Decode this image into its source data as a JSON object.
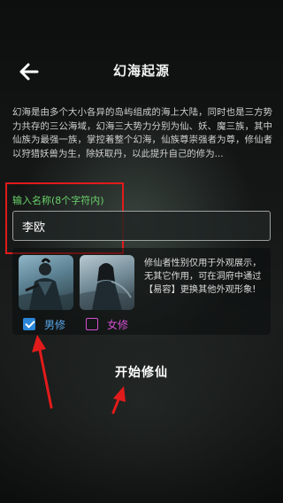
{
  "header": {
    "title": "幻海起源",
    "back_icon": "arrow-left-icon"
  },
  "description": "幻海是由多个大小各异的岛屿组成的海上大陆，同时也是三方势力共存的三公海域，幻海三大势力分别为仙、妖、魔三族，其中仙族为最强一族，掌控着整个幻海，仙族尊崇强者为尊，修仙者以狩猎妖兽为生，除妖取丹，以此提升自己的修为...",
  "name_section": {
    "label": "输入名称(8个字符内)",
    "value": "李欧",
    "highlight_color": "#e11b1b"
  },
  "character": {
    "note": "修仙者性别仅用于外观展示，无其它作用，可在洞府中通过【易容】更换其他外观形象!",
    "options": [
      {
        "label": "男修",
        "checked": true,
        "color": "#2a86d9"
      },
      {
        "label": "女修",
        "checked": false,
        "color": "#d24fd0"
      }
    ]
  },
  "start_button": {
    "label": "开始修仙"
  },
  "annotations": {
    "arrow_color": "#e11b1b"
  }
}
